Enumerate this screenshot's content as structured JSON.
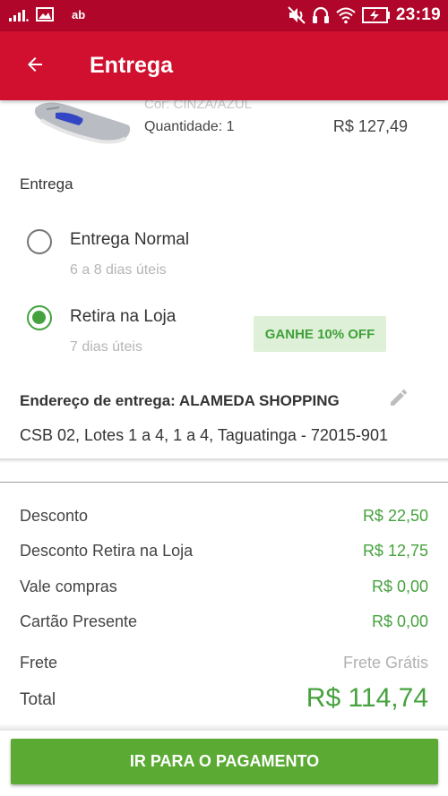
{
  "status_bar": {
    "time": "23:19",
    "carrier_glyph": "ab",
    "icons": [
      "signal-icon",
      "image-icon",
      "carrier-icon",
      "mute-icon",
      "headset-icon",
      "wifi-icon",
      "battery-charging-icon"
    ]
  },
  "app_bar": {
    "title": "Entrega",
    "back_icon": "arrow-back-icon",
    "color": "#d0102e"
  },
  "product": {
    "color_text": "Cor: CINZA/AZUL",
    "quantity_text": "Quantidade: 1",
    "price": "R$ 127,49"
  },
  "delivery": {
    "section_label": "Entrega",
    "options": [
      {
        "title": "Entrega Normal",
        "subtitle": "6 a 8 dias úteis",
        "selected": false
      },
      {
        "title": "Retira na Loja",
        "subtitle": "7 dias úteis",
        "selected": true
      }
    ],
    "promo_badge": "GANHE 10% OFF"
  },
  "address": {
    "title": "Endereço de entrega: ALAMEDA SHOPPING",
    "text": "CSB 02, Lotes 1 a 4, 1 a 4, Taguatinga - 72015-901",
    "edit_icon": "pencil-icon"
  },
  "summary": {
    "discount_label": "Desconto",
    "discount_value": "R$ 22,50",
    "store_discount_label": "Desconto Retira na Loja",
    "store_discount_value": "R$ 12,75",
    "voucher_label": "Vale compras",
    "voucher_value": "R$ 0,00",
    "gift_card_label": "Cartão Presente",
    "gift_card_value": "R$ 0,00",
    "shipping_label": "Frete",
    "shipping_value": "Frete Grátis",
    "total_label": "Total",
    "total_value": "R$ 114,74"
  },
  "actions": {
    "pay_button": "IR PARA O PAGAMENTO"
  },
  "colors": {
    "status_bar": "#b0062a",
    "accent_green": "#46a23e",
    "button_green": "#5aaa33",
    "badge_bg": "#dff0d8"
  }
}
